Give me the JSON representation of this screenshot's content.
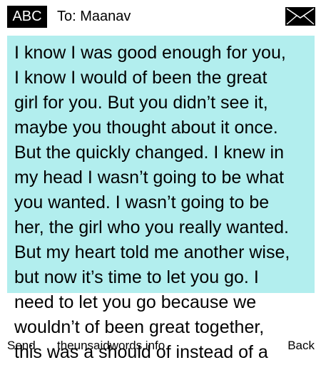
{
  "header": {
    "input_mode": "ABC",
    "recipient": "To: Maanav"
  },
  "icons": {
    "send": "envelope-icon"
  },
  "colors": {
    "message_background": "#b2eeee",
    "badge_background": "#000000",
    "badge_text": "#ffffff"
  },
  "message": {
    "text": "I know I was good enough for you,\nI know I would of been the great\ngirl for you. But you didn’t see it,\nmaybe you thought about it once.\nBut the quickly changed. I knew in\nmy head I wasn’t going to be what\nyou wanted. I wasn’t going to be\nher, the girl who you really wanted.\nBut my heart told me another wise,\nbut now it’s time to let you go. I\nneed to let you go because we\nwouldn’t of been great together,\nthis was a should of instead of a"
  },
  "softkeys": {
    "left": "Send",
    "center": "theunsaidwords.info",
    "right": "Back"
  }
}
